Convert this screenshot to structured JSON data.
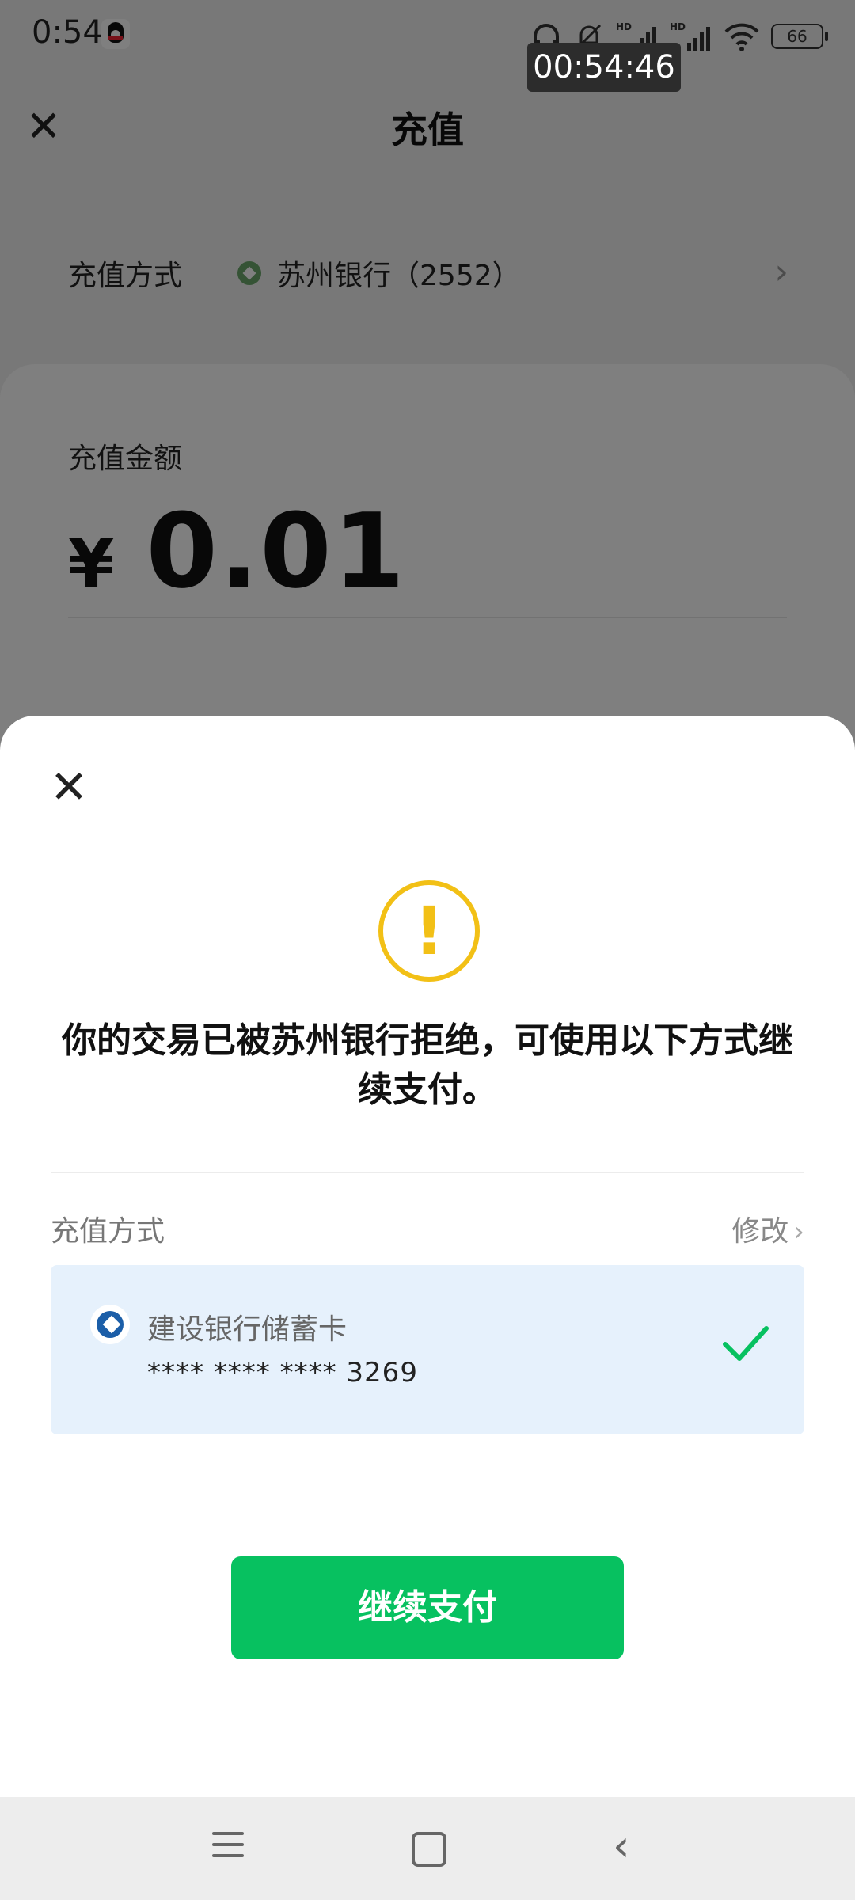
{
  "status_bar": {
    "time": "0:54",
    "battery": "66",
    "hd_labels": [
      "HD",
      "HD"
    ]
  },
  "recording_timer": "00:54:46",
  "header": {
    "title": "充值"
  },
  "recharge_method": {
    "label": "充值方式",
    "bank": "苏州银行（2552）"
  },
  "amount": {
    "label": "充值金额",
    "currency": "¥",
    "value": "0.01"
  },
  "sheet": {
    "message": "你的交易已被苏州银行拒绝，可使用以下方式继续支付。",
    "pay_method_label": "充值方式",
    "modify_label": "修改",
    "card": {
      "name": "建设银行储蓄卡",
      "number": "**** **** **** 3269"
    },
    "continue_label": "继续支付"
  },
  "colors": {
    "primary_green": "#07c160",
    "warning_yellow": "#f2c016",
    "selected_bg": "#e6f1fc"
  },
  "icons": [
    "close-icon",
    "chevron-right-icon",
    "warning-icon",
    "checkmark-icon",
    "ccb-bank-icon",
    "suzhou-bank-icon",
    "qq-icon",
    "headphones-icon",
    "mute-icon",
    "signal-icon",
    "wifi-icon",
    "battery-icon"
  ]
}
